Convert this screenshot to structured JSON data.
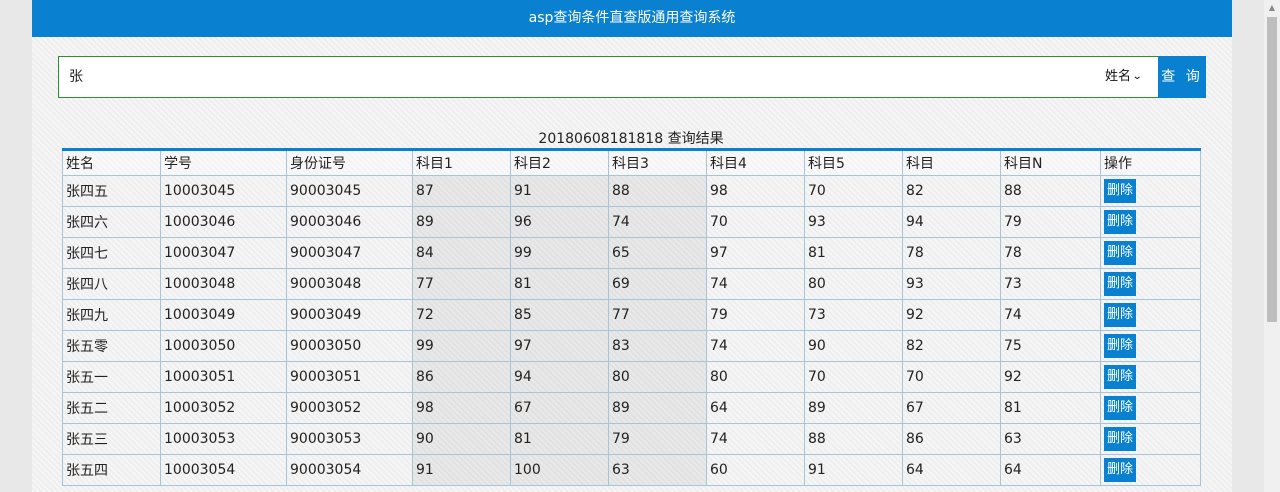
{
  "header": {
    "title": "asp查询条件直查版通用查询系统"
  },
  "search": {
    "value": "张",
    "field": "姓名",
    "button": "查 询"
  },
  "results": {
    "caption": "20180608181818 查询结果",
    "columns": [
      "姓名",
      "学号",
      "身份证号",
      "科目1",
      "科目2",
      "科目3",
      "科目4",
      "科目5",
      "科目",
      "科目N",
      "操作"
    ],
    "delete_label": "删除",
    "rows": [
      [
        "张四五",
        "10003045",
        "90003045",
        "87",
        "91",
        "88",
        "98",
        "70",
        "82",
        "88"
      ],
      [
        "张四六",
        "10003046",
        "90003046",
        "89",
        "96",
        "74",
        "70",
        "93",
        "94",
        "79"
      ],
      [
        "张四七",
        "10003047",
        "90003047",
        "84",
        "99",
        "65",
        "97",
        "81",
        "78",
        "78"
      ],
      [
        "张四八",
        "10003048",
        "90003048",
        "77",
        "81",
        "69",
        "74",
        "80",
        "93",
        "73"
      ],
      [
        "张四九",
        "10003049",
        "90003049",
        "72",
        "85",
        "77",
        "79",
        "73",
        "92",
        "74"
      ],
      [
        "张五零",
        "10003050",
        "90003050",
        "99",
        "97",
        "83",
        "74",
        "90",
        "82",
        "75"
      ],
      [
        "张五一",
        "10003051",
        "90003051",
        "86",
        "94",
        "80",
        "80",
        "70",
        "70",
        "92"
      ],
      [
        "张五二",
        "10003052",
        "90003052",
        "98",
        "67",
        "89",
        "64",
        "89",
        "67",
        "81"
      ],
      [
        "张五三",
        "10003053",
        "90003053",
        "90",
        "81",
        "79",
        "74",
        "88",
        "86",
        "63"
      ],
      [
        "张五四",
        "10003054",
        "90003054",
        "91",
        "100",
        "63",
        "60",
        "91",
        "64",
        "64"
      ]
    ]
  },
  "colors": {
    "accent": "#0a80d0",
    "search_border": "#2f8f2f"
  },
  "icons": {
    "select_arrow": "chevron-down-icon",
    "scroll_up": "arrow-up-icon"
  }
}
